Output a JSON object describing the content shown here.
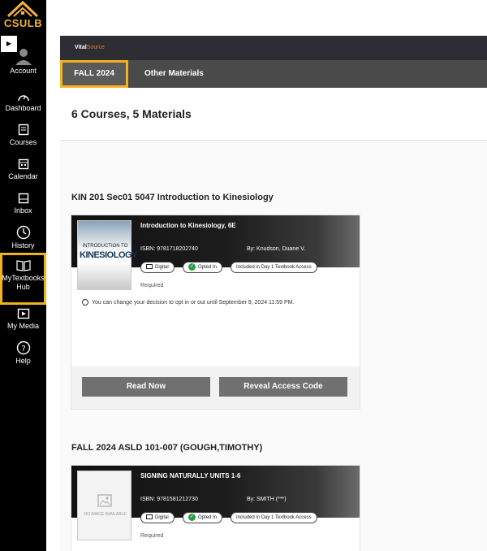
{
  "nav": {
    "logo_text": "CSULB",
    "items": [
      {
        "label": "Account",
        "icon": "user-icon"
      },
      {
        "label": "Dashboard",
        "icon": "dashboard-icon"
      },
      {
        "label": "Courses",
        "icon": "courses-icon"
      },
      {
        "label": "Calendar",
        "icon": "calendar-icon"
      },
      {
        "label": "Inbox",
        "icon": "inbox-icon"
      },
      {
        "label": "History",
        "icon": "clock-icon"
      },
      {
        "label": "MyTextbooks Hub",
        "icon": "book-icon"
      },
      {
        "label": "My Media",
        "icon": "media-icon"
      },
      {
        "label": "Help",
        "icon": "help-icon"
      }
    ]
  },
  "vitalsource": {
    "brand_a": "Vital",
    "brand_b": "Source"
  },
  "tabs": [
    {
      "label": "FALL 2024"
    },
    {
      "label": "Other Materials"
    }
  ],
  "summary": "6 Courses,  5 Materials",
  "courses": [
    {
      "title": "KIN 201 Sec01 5047 Introduction to Kinesiology",
      "book": {
        "title": "Introduction to Kinesiology, 6E",
        "isbn": "ISBN: 9781718202740",
        "author": "By: Knudson, Duane V.",
        "cover_line1": "INTRODUCTION TO",
        "cover_line2": "KINESIOLOGY",
        "pills": [
          "Digital",
          "Opted In",
          "Included in Day 1 Textbook Access"
        ],
        "required": "Required",
        "note": "You can change your decision to opt in or out until September 9, 2024 11:59 PM."
      },
      "buttons": {
        "read": "Read Now",
        "reveal": "Reveal Access Code"
      }
    },
    {
      "title": "FALL 2024 ASLD 101-007 (GOUGH,TIMOTHY)",
      "book": {
        "title": "SIGNING NATURALLY UNITS 1-6",
        "isbn": "ISBN: 9781581212730",
        "author": "By: SMITH (***)",
        "no_image": "NO IMAGE AVAILABLE",
        "pills": [
          "Digital",
          "Opted In",
          "Included in Day 1 Textbook Access"
        ],
        "required": "Required"
      }
    }
  ]
}
